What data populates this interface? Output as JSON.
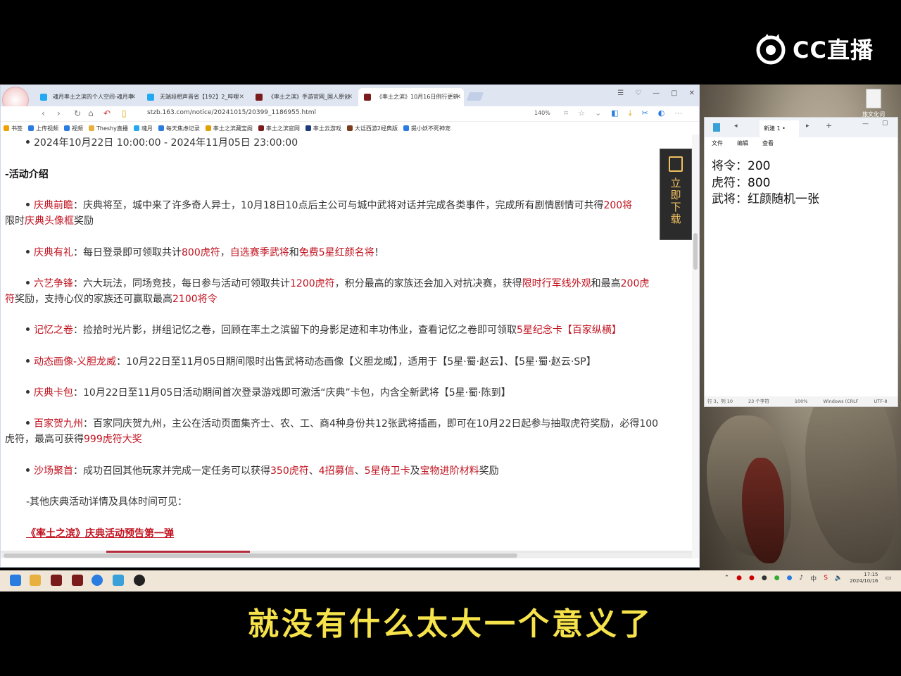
{
  "logo": {
    "text": "CC直播"
  },
  "browser": {
    "tabs": [
      {
        "label": "魂月率土之滨的个人空间-魂月率",
        "active": false
      },
      {
        "label": "无端段相声晋省【192】2_哔哩",
        "active": false
      },
      {
        "label": "《率土之滨》手游官网_国人原创",
        "active": false
      },
      {
        "label": "《率土之滨》10月16日例行更新",
        "active": true
      }
    ],
    "url": "stzb.163.com/notice/20241015/20399_1186955.html",
    "zoom": "140%",
    "bookmarks": [
      "书签",
      "上传视频",
      "视频",
      "Theshy直播",
      "魂月",
      "每天焦虑记录",
      "率土之滨藏宝阁",
      "率土之滨官网",
      "率土云游戏",
      "大话西游2经典版",
      "提小妖不死神宠"
    ],
    "download_button": "立即下载",
    "content": {
      "date_line": "2024年10月22日 10:00:00 - 2024年11月05日 23:00:00",
      "section_title": "-活动介绍",
      "items": [
        {
          "title": "庆典前瞻",
          "l1": "：庆典将至，城中来了许多奇人异士，10月18日10点后主公可与城中武将对话并完成各类事件，完成所有剧情剧情可共得",
          "l1red": "200将",
          "l2a": "限时",
          "l2red": "庆典头像框",
          "l2b": "奖励"
        },
        {
          "title": "庆典有礼",
          "a": "：每日登录即可领取共计",
          "r1": "800虎符",
          "b": "，",
          "r2": "自选赛季武将",
          "c": "和",
          "r3": "免费5星红颜名将",
          "d": "！"
        },
        {
          "title": "六艺争锋",
          "a": "：六大玩法，同场竞技，每日参与活动可领取共计",
          "r1": "1200虎符",
          "b": "，积分最高的家族还会加入对抗决赛，获得",
          "r2": "限时行军线外观",
          "c": "和最高",
          "r3": "200虎",
          "l2r": "符",
          "l2a": "奖励，支持心仪的家族还可赢取最高",
          "l2r2": "2100将令"
        },
        {
          "title": "记忆之卷",
          "a": "：捡拾时光片影，拼组记忆之卷，回顾在率土之滨留下的身影足迹和丰功伟业，查看记忆之卷即可领取",
          "r1": "5星纪念卡【百家纵横】"
        },
        {
          "title": "动态画像-义胆龙威",
          "a": "：10月22日至11月05日期间限时出售武将动态画像【义胆龙威】，适用于【5星·蜀·赵云】、【5星·蜀·赵云·SP】"
        },
        {
          "title": "庆典卡包",
          "a": "：10月22日至11月05日活动期间首次登录游戏即可激活“庆典”卡包，内含全新武将【5星·蜀·陈到】"
        },
        {
          "title": "百家贺九州",
          "a": "：百家同庆贺九州，主公在活动页面集齐士、农、工、商4种身份共12张武将插画，即可在10月22日起参与抽取虎符奖励，必得100",
          "l2a": "虎符，最高可获得",
          "l2r": "999虎符大奖"
        },
        {
          "title": "沙场聚首",
          "a": "：成功召回其他玩家并完成一定任务可以获得",
          "r1": "350虎符",
          "b": "、",
          "r2": "4招募信",
          "c": "、",
          "r3": "5星侍卫卡",
          "d": "及",
          "r4": "宝物进阶材料",
          "e": "奖励"
        }
      ],
      "other_line": "-其他庆典活动详情及具体时间可见：",
      "link": "《率土之滨》庆典活动预告第一弹"
    }
  },
  "notepad": {
    "tab_title": "新建 1",
    "menu": [
      "文件",
      "编辑",
      "查看"
    ],
    "lines": [
      "将令：200",
      "虎符：800",
      "武将：红颜随机一张"
    ],
    "status": [
      "行 3，列 10",
      "23 个字符",
      "100%",
      "Windows (CRLF",
      "UTF-8"
    ]
  },
  "desktop": {
    "icon_label": "旅文化词等"
  },
  "taskbar": {
    "time": "17:15",
    "date": "2024/10/16",
    "ime": "中"
  },
  "subtitle": "就没有什么太大一个意义了"
}
